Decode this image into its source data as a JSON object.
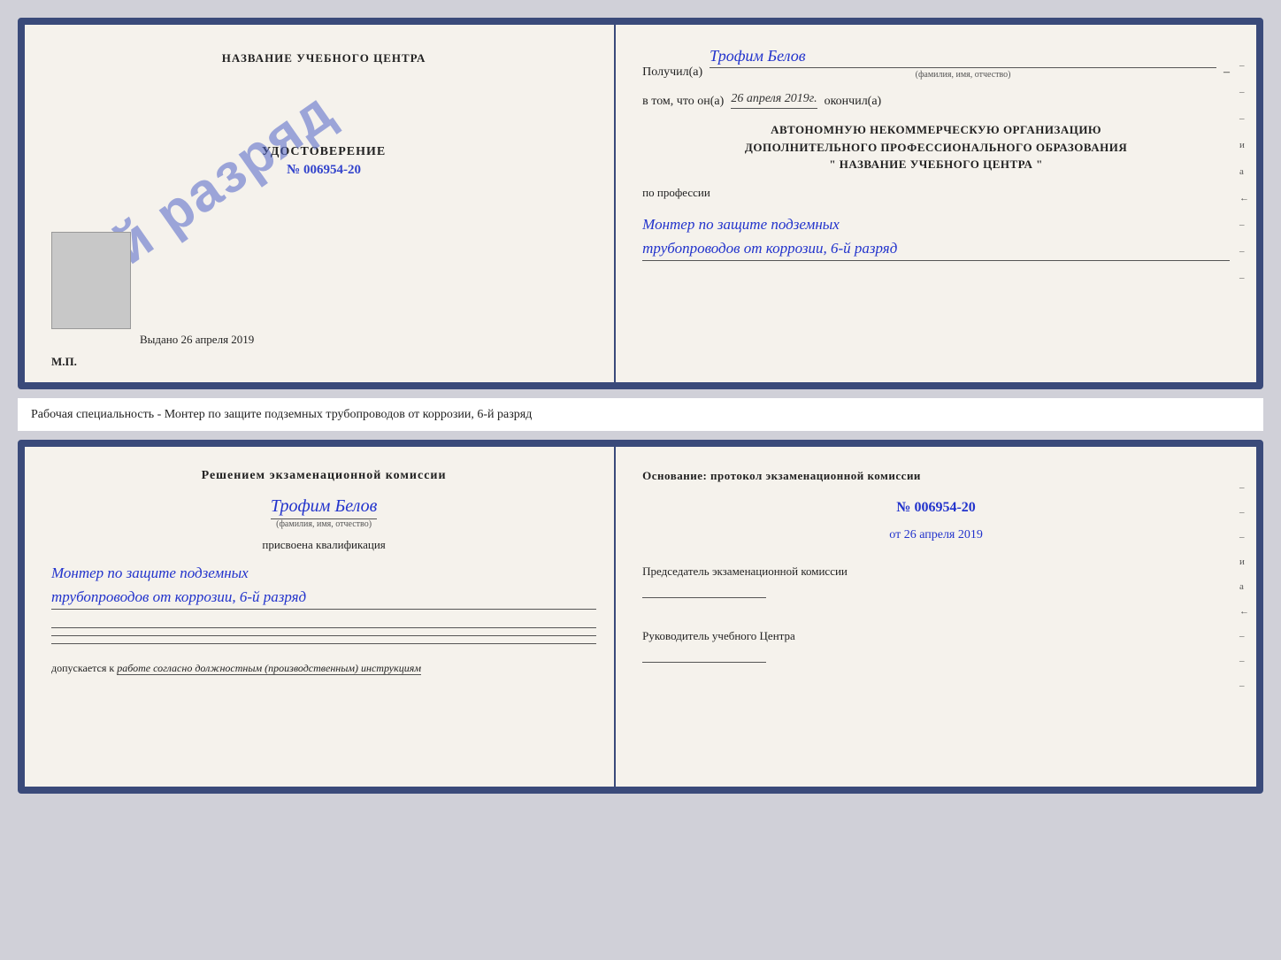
{
  "top_cert": {
    "left": {
      "org_name": "НАЗВАНИЕ УЧЕБНОГО ЦЕНТРА",
      "stamp_text": "6-й разряд",
      "udostoverenie_title": "УДОСТОВЕРЕНИЕ",
      "udostoverenie_number": "№ 006954-20",
      "vydano_label": "Выдано",
      "vydano_date": "26 апреля 2019",
      "mp": "М.П."
    },
    "right": {
      "poluchil_label": "Получил(а)",
      "poluchil_name": "Трофим Белов",
      "poluchil_sub": "(фамилия, имя, отчество)",
      "dash": "–",
      "vtom_label": "в том, что он(а)",
      "vtom_date": "26 апреля 2019г.",
      "okonchil": "окончил(а)",
      "org_line1": "АВТОНОМНУЮ НЕКОММЕРЧЕСКУЮ ОРГАНИЗАЦИЮ",
      "org_line2": "ДОПОЛНИТЕЛЬНОГО ПРОФЕССИОНАЛЬНОГО ОБРАЗОВАНИЯ",
      "org_line3": "\" НАЗВАНИЕ УЧЕБНОГО ЦЕНТРА \"",
      "po_professii": "по профессии",
      "professii_line1": "Монтер по защите подземных",
      "professii_line2": "трубопроводов от коррозии, 6-й разряд",
      "side_marks": [
        "–",
        "–",
        "–",
        "и",
        "а",
        "←",
        "–",
        "–",
        "–"
      ]
    }
  },
  "working_specialty": {
    "text": "Рабочая специальность - Монтер по защите подземных трубопроводов от коррозии, 6-й разряд"
  },
  "bottom_cert": {
    "left": {
      "resheniem_title": "Решением экзаменационной комиссии",
      "name": "Трофим Белов",
      "name_sub": "(фамилия, имя, отчество)",
      "prisvoena": "присвоена квалификация",
      "qualification_line1": "Монтер по защите подземных",
      "qualification_line2": "трубопроводов от коррозии, 6-й разряд",
      "dopuskaetsya_label": "допускается к",
      "dopuskaetsya_text": "работе согласно должностным (производственным) инструкциям"
    },
    "right": {
      "osnovanie_label": "Основание: протокол экзаменационной комиссии",
      "protocol_number": "№ 006954-20",
      "ot_label": "от",
      "protocol_date": "26 апреля 2019",
      "chairman_label": "Председатель экзаменационной комиссии",
      "rukovoditel_label": "Руководитель учебного Центра",
      "side_marks": [
        "–",
        "–",
        "–",
        "и",
        "а",
        "←",
        "–",
        "–",
        "–"
      ]
    }
  }
}
